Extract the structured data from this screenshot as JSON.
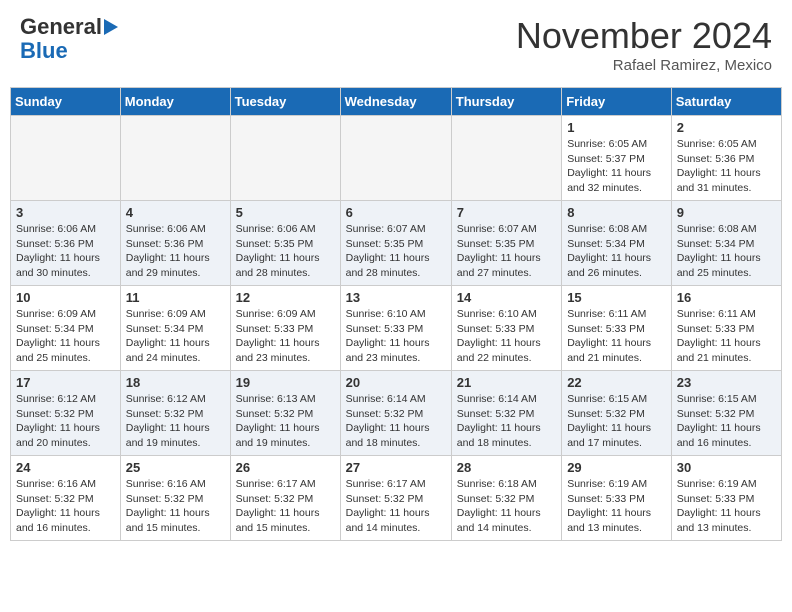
{
  "header": {
    "logo_line1": "General",
    "logo_line2": "Blue",
    "month": "November 2024",
    "subtitle": "Rafael Ramirez, Mexico"
  },
  "days_of_week": [
    "Sunday",
    "Monday",
    "Tuesday",
    "Wednesday",
    "Thursday",
    "Friday",
    "Saturday"
  ],
  "weeks": [
    {
      "days": [
        {
          "num": "",
          "empty": true
        },
        {
          "num": "",
          "empty": true
        },
        {
          "num": "",
          "empty": true
        },
        {
          "num": "",
          "empty": true
        },
        {
          "num": "",
          "empty": true
        },
        {
          "num": "1",
          "info": "Sunrise: 6:05 AM\nSunset: 5:37 PM\nDaylight: 11 hours\nand 32 minutes."
        },
        {
          "num": "2",
          "info": "Sunrise: 6:05 AM\nSunset: 5:36 PM\nDaylight: 11 hours\nand 31 minutes."
        }
      ]
    },
    {
      "days": [
        {
          "num": "3",
          "info": "Sunrise: 6:06 AM\nSunset: 5:36 PM\nDaylight: 11 hours\nand 30 minutes."
        },
        {
          "num": "4",
          "info": "Sunrise: 6:06 AM\nSunset: 5:36 PM\nDaylight: 11 hours\nand 29 minutes."
        },
        {
          "num": "5",
          "info": "Sunrise: 6:06 AM\nSunset: 5:35 PM\nDaylight: 11 hours\nand 28 minutes."
        },
        {
          "num": "6",
          "info": "Sunrise: 6:07 AM\nSunset: 5:35 PM\nDaylight: 11 hours\nand 28 minutes."
        },
        {
          "num": "7",
          "info": "Sunrise: 6:07 AM\nSunset: 5:35 PM\nDaylight: 11 hours\nand 27 minutes."
        },
        {
          "num": "8",
          "info": "Sunrise: 6:08 AM\nSunset: 5:34 PM\nDaylight: 11 hours\nand 26 minutes."
        },
        {
          "num": "9",
          "info": "Sunrise: 6:08 AM\nSunset: 5:34 PM\nDaylight: 11 hours\nand 25 minutes."
        }
      ]
    },
    {
      "days": [
        {
          "num": "10",
          "info": "Sunrise: 6:09 AM\nSunset: 5:34 PM\nDaylight: 11 hours\nand 25 minutes."
        },
        {
          "num": "11",
          "info": "Sunrise: 6:09 AM\nSunset: 5:34 PM\nDaylight: 11 hours\nand 24 minutes."
        },
        {
          "num": "12",
          "info": "Sunrise: 6:09 AM\nSunset: 5:33 PM\nDaylight: 11 hours\nand 23 minutes."
        },
        {
          "num": "13",
          "info": "Sunrise: 6:10 AM\nSunset: 5:33 PM\nDaylight: 11 hours\nand 23 minutes."
        },
        {
          "num": "14",
          "info": "Sunrise: 6:10 AM\nSunset: 5:33 PM\nDaylight: 11 hours\nand 22 minutes."
        },
        {
          "num": "15",
          "info": "Sunrise: 6:11 AM\nSunset: 5:33 PM\nDaylight: 11 hours\nand 21 minutes."
        },
        {
          "num": "16",
          "info": "Sunrise: 6:11 AM\nSunset: 5:33 PM\nDaylight: 11 hours\nand 21 minutes."
        }
      ]
    },
    {
      "days": [
        {
          "num": "17",
          "info": "Sunrise: 6:12 AM\nSunset: 5:32 PM\nDaylight: 11 hours\nand 20 minutes."
        },
        {
          "num": "18",
          "info": "Sunrise: 6:12 AM\nSunset: 5:32 PM\nDaylight: 11 hours\nand 19 minutes."
        },
        {
          "num": "19",
          "info": "Sunrise: 6:13 AM\nSunset: 5:32 PM\nDaylight: 11 hours\nand 19 minutes."
        },
        {
          "num": "20",
          "info": "Sunrise: 6:14 AM\nSunset: 5:32 PM\nDaylight: 11 hours\nand 18 minutes."
        },
        {
          "num": "21",
          "info": "Sunrise: 6:14 AM\nSunset: 5:32 PM\nDaylight: 11 hours\nand 18 minutes."
        },
        {
          "num": "22",
          "info": "Sunrise: 6:15 AM\nSunset: 5:32 PM\nDaylight: 11 hours\nand 17 minutes."
        },
        {
          "num": "23",
          "info": "Sunrise: 6:15 AM\nSunset: 5:32 PM\nDaylight: 11 hours\nand 16 minutes."
        }
      ]
    },
    {
      "days": [
        {
          "num": "24",
          "info": "Sunrise: 6:16 AM\nSunset: 5:32 PM\nDaylight: 11 hours\nand 16 minutes."
        },
        {
          "num": "25",
          "info": "Sunrise: 6:16 AM\nSunset: 5:32 PM\nDaylight: 11 hours\nand 15 minutes."
        },
        {
          "num": "26",
          "info": "Sunrise: 6:17 AM\nSunset: 5:32 PM\nDaylight: 11 hours\nand 15 minutes."
        },
        {
          "num": "27",
          "info": "Sunrise: 6:17 AM\nSunset: 5:32 PM\nDaylight: 11 hours\nand 14 minutes."
        },
        {
          "num": "28",
          "info": "Sunrise: 6:18 AM\nSunset: 5:32 PM\nDaylight: 11 hours\nand 14 minutes."
        },
        {
          "num": "29",
          "info": "Sunrise: 6:19 AM\nSunset: 5:33 PM\nDaylight: 11 hours\nand 13 minutes."
        },
        {
          "num": "30",
          "info": "Sunrise: 6:19 AM\nSunset: 5:33 PM\nDaylight: 11 hours\nand 13 minutes."
        }
      ]
    }
  ]
}
